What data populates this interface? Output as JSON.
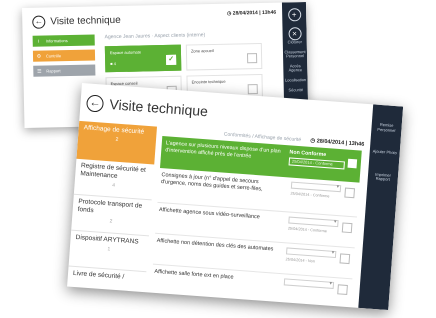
{
  "colors": {
    "green": "#5cb134",
    "orange": "#f0a23a",
    "rail": "#1f2a3a"
  },
  "screen1": {
    "title": "Visite technique",
    "datetime": "28/04/2014 | 13h46",
    "breadcrumb": "Agence Jean Jaures · Aspect clients (interne)",
    "sidebar": [
      {
        "icon": "info-icon",
        "glyph": "i",
        "label": "Informations",
        "color": "#5cb134"
      },
      {
        "icon": "gear-icon",
        "glyph": "⚙",
        "label": "Contrôle",
        "color": "#f0a23a"
      },
      {
        "icon": "list-icon",
        "glyph": "☰",
        "label": "Rapport",
        "color": "#9ea4ab"
      }
    ],
    "cards": [
      {
        "label": "Espace automate",
        "sub": "■ 4",
        "state": "checked"
      },
      {
        "label": "Zone accueil",
        "sub": "",
        "state": "empty"
      },
      {
        "label": "Espace conseil",
        "sub": "",
        "state": "empty"
      },
      {
        "label": "Enceinte technique",
        "sub": "",
        "state": "empty"
      }
    ],
    "rail": [
      {
        "icon": "plus-icon",
        "glyph": "+",
        "label": ""
      },
      {
        "icon": "close-icon",
        "glyph": "×",
        "label": "Clôturer"
      },
      {
        "icon": "",
        "glyph": "",
        "label": "Classement Personnel"
      },
      {
        "icon": "",
        "glyph": "",
        "label": "Accès Agence"
      },
      {
        "icon": "",
        "glyph": "",
        "label": "Localisation"
      },
      {
        "icon": "",
        "glyph": "",
        "label": "Sécurité"
      }
    ]
  },
  "screen2": {
    "title": "Visite technique",
    "datetime": "28/04/2014 | 13h46",
    "breadcrumb": "Conformités / Affichage de sécurité",
    "sidebar": [
      {
        "label": "Affichage de sécurité",
        "sub": "2",
        "selected": true
      },
      {
        "label": "Registre de sécurité et Maintenance",
        "sub": "4",
        "selected": false
      },
      {
        "label": "Protocole transport de fonds",
        "sub": "2",
        "selected": false
      },
      {
        "label": "Dispositif ARYTRANS",
        "sub": "1",
        "selected": false
      },
      {
        "label": "Livre de sécurité /",
        "sub": "",
        "selected": false
      }
    ],
    "banner": {
      "text": "L'agence sur plusieurs niveaux dispose d'un plan d'intervention affiché près de l'entrée",
      "status": "Non Conforme",
      "dropdown": "25/04/2014 - Conforme"
    },
    "rows": [
      {
        "text": "Consignes à jour (n° d'appel de secours d'urgence, noms des guides et serre-files,",
        "status": "25/04/2014 - Conforme"
      },
      {
        "text": "Affichette agence sous vidéo-surveillance",
        "status": "25/04/2014 - Conforme"
      },
      {
        "text": "Affichette non détention des clés des automates",
        "status": "25/04/2014 - Non"
      },
      {
        "text": "Affichette salle forte ext en place",
        "status": ""
      }
    ],
    "rail": [
      {
        "label": "Remise Personnel"
      },
      {
        "label": "Ajouter Photo"
      },
      {
        "label": "Imprimer Rapport"
      }
    ]
  }
}
